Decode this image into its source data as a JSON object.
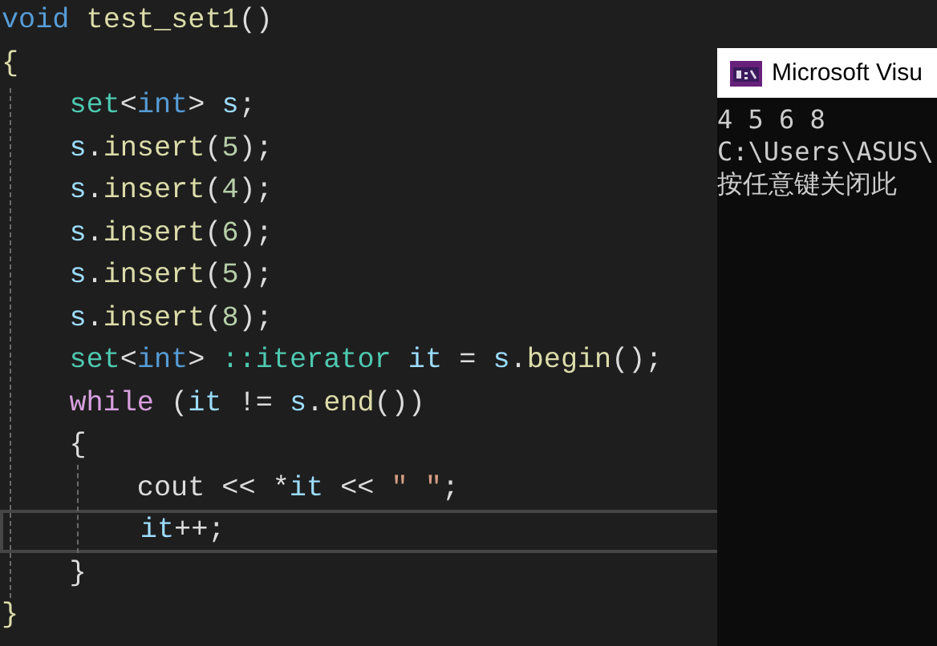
{
  "editor": {
    "lines": [
      {
        "current": false,
        "tokens": [
          {
            "kind": "keyword",
            "text": "void"
          },
          {
            "kind": "function",
            "text": " test_set1"
          },
          {
            "kind": "punct",
            "text": "()"
          }
        ]
      },
      {
        "current": false,
        "tokens": [
          {
            "kind": "function",
            "text": "{"
          }
        ],
        "children": [
          {
            "current": false,
            "tokens": [
              {
                "kind": "type",
                "text": "set"
              },
              {
                "kind": "punct",
                "text": "<"
              },
              {
                "kind": "keyword",
                "text": "int"
              },
              {
                "kind": "punct",
                "text": "> "
              },
              {
                "kind": "variable",
                "text": "s"
              },
              {
                "kind": "punct",
                "text": ";"
              }
            ]
          },
          {
            "current": false,
            "tokens": [
              {
                "kind": "variable",
                "text": "s"
              },
              {
                "kind": "punct",
                "text": "."
              },
              {
                "kind": "function",
                "text": "insert"
              },
              {
                "kind": "punct",
                "text": "("
              },
              {
                "kind": "number",
                "text": "5"
              },
              {
                "kind": "punct",
                "text": ");"
              }
            ]
          },
          {
            "current": false,
            "tokens": [
              {
                "kind": "variable",
                "text": "s"
              },
              {
                "kind": "punct",
                "text": "."
              },
              {
                "kind": "function",
                "text": "insert"
              },
              {
                "kind": "punct",
                "text": "("
              },
              {
                "kind": "number",
                "text": "4"
              },
              {
                "kind": "punct",
                "text": ");"
              }
            ]
          },
          {
            "current": false,
            "tokens": [
              {
                "kind": "variable",
                "text": "s"
              },
              {
                "kind": "punct",
                "text": "."
              },
              {
                "kind": "function",
                "text": "insert"
              },
              {
                "kind": "punct",
                "text": "("
              },
              {
                "kind": "number",
                "text": "6"
              },
              {
                "kind": "punct",
                "text": ");"
              }
            ]
          },
          {
            "current": false,
            "tokens": [
              {
                "kind": "variable",
                "text": "s"
              },
              {
                "kind": "punct",
                "text": "."
              },
              {
                "kind": "function",
                "text": "insert"
              },
              {
                "kind": "punct",
                "text": "("
              },
              {
                "kind": "number",
                "text": "5"
              },
              {
                "kind": "punct",
                "text": ");"
              }
            ]
          },
          {
            "current": false,
            "tokens": [
              {
                "kind": "variable",
                "text": "s"
              },
              {
                "kind": "punct",
                "text": "."
              },
              {
                "kind": "function",
                "text": "insert"
              },
              {
                "kind": "punct",
                "text": "("
              },
              {
                "kind": "number",
                "text": "8"
              },
              {
                "kind": "punct",
                "text": ");"
              }
            ]
          },
          {
            "current": false,
            "tokens": [
              {
                "kind": "type",
                "text": "set"
              },
              {
                "kind": "punct",
                "text": "<"
              },
              {
                "kind": "keyword",
                "text": "int"
              },
              {
                "kind": "punct",
                "text": "> "
              },
              {
                "kind": "type",
                "text": "::iterator "
              },
              {
                "kind": "variable",
                "text": "it"
              },
              {
                "kind": "punct",
                "text": " = "
              },
              {
                "kind": "variable",
                "text": "s"
              },
              {
                "kind": "punct",
                "text": "."
              },
              {
                "kind": "function",
                "text": "begin"
              },
              {
                "kind": "punct",
                "text": "();"
              }
            ]
          },
          {
            "current": false,
            "tokens": [
              {
                "kind": "control",
                "text": "while"
              },
              {
                "kind": "punct",
                "text": " ("
              },
              {
                "kind": "variable",
                "text": "it"
              },
              {
                "kind": "punct",
                "text": " != "
              },
              {
                "kind": "variable",
                "text": "s"
              },
              {
                "kind": "punct",
                "text": "."
              },
              {
                "kind": "function",
                "text": "end"
              },
              {
                "kind": "punct",
                "text": "())"
              }
            ]
          },
          {
            "current": false,
            "tokens": [
              {
                "kind": "punct",
                "text": "{"
              }
            ],
            "children": [
              {
                "current": false,
                "tokens": [
                  {
                    "kind": "punct",
                    "text": "cout << *"
                  },
                  {
                    "kind": "variable",
                    "text": "it"
                  },
                  {
                    "kind": "punct",
                    "text": " << "
                  },
                  {
                    "kind": "string",
                    "text": "\" \""
                  },
                  {
                    "kind": "punct",
                    "text": ";"
                  }
                ]
              },
              {
                "current": true,
                "tokens": [
                  {
                    "kind": "variable",
                    "text": "it"
                  },
                  {
                    "kind": "punct",
                    "text": "++;"
                  }
                ]
              }
            ]
          },
          {
            "current": false,
            "tokens": [
              {
                "kind": "punct",
                "text": "}"
              }
            ]
          }
        ]
      },
      {
        "current": false,
        "tokens": [
          {
            "kind": "function",
            "text": "}"
          }
        ]
      }
    ]
  },
  "console": {
    "title": "Microsoft Visu",
    "lines": [
      "4 5 6 8",
      "C:\\Users\\ASUS\\",
      "按任意键关闭此"
    ]
  }
}
